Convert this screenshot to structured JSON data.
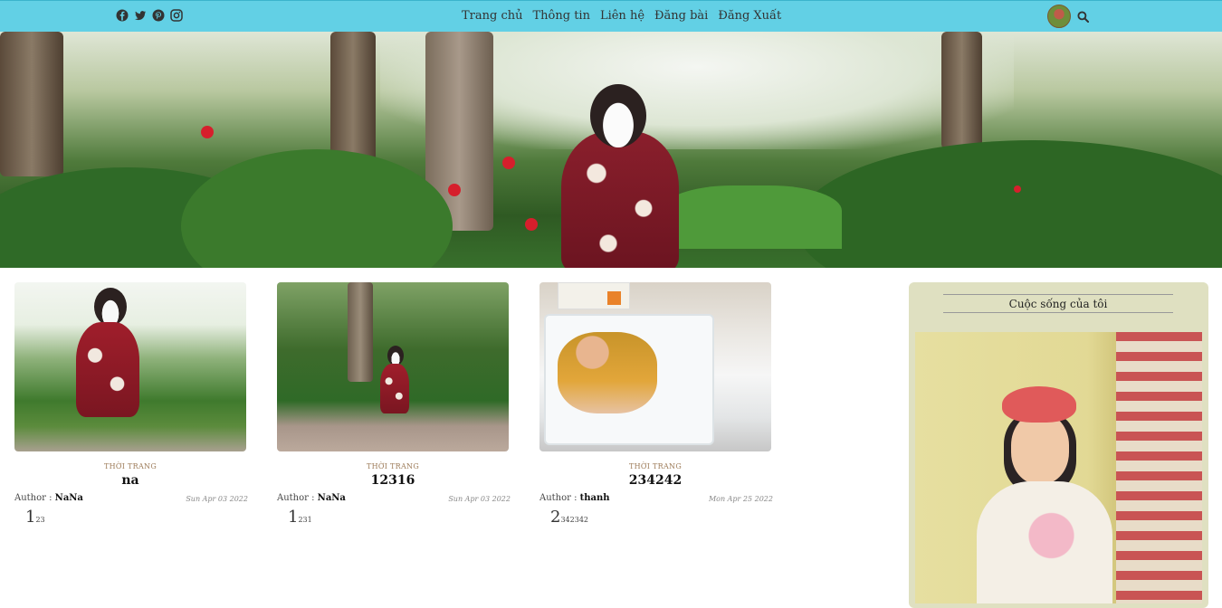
{
  "nav": {
    "social": [
      "facebook-icon",
      "twitter-icon",
      "pinterest-icon",
      "instagram-icon"
    ],
    "links": [
      "Trang chủ",
      "Thông tin",
      "Liên hệ",
      "Đăng bài",
      "Đăng Xuất"
    ]
  },
  "posts": [
    {
      "category": "THỜI TRANG",
      "title": "na",
      "author_label": "Author :",
      "author": "NaNa",
      "date": "Sun Apr 03 2022",
      "excerpt_big": "1",
      "excerpt_rest": "23"
    },
    {
      "category": "THỜI TRANG",
      "title": "12316",
      "author_label": "Author :",
      "author": "NaNa",
      "date": "Sun Apr 03 2022",
      "excerpt_big": "1",
      "excerpt_rest": "231"
    },
    {
      "category": "THỜI TRANG",
      "title": "234242",
      "author_label": "Author :",
      "author": "thanh",
      "date": "Mon Apr 25 2022",
      "excerpt_big": "2",
      "excerpt_rest": "342342"
    }
  ],
  "sidebar": {
    "title": "Cuộc sống của tôi"
  },
  "colors": {
    "navbar": "#62d0e5",
    "sidebar_bg": "#dfe0c1",
    "category": "#9c7a57"
  }
}
